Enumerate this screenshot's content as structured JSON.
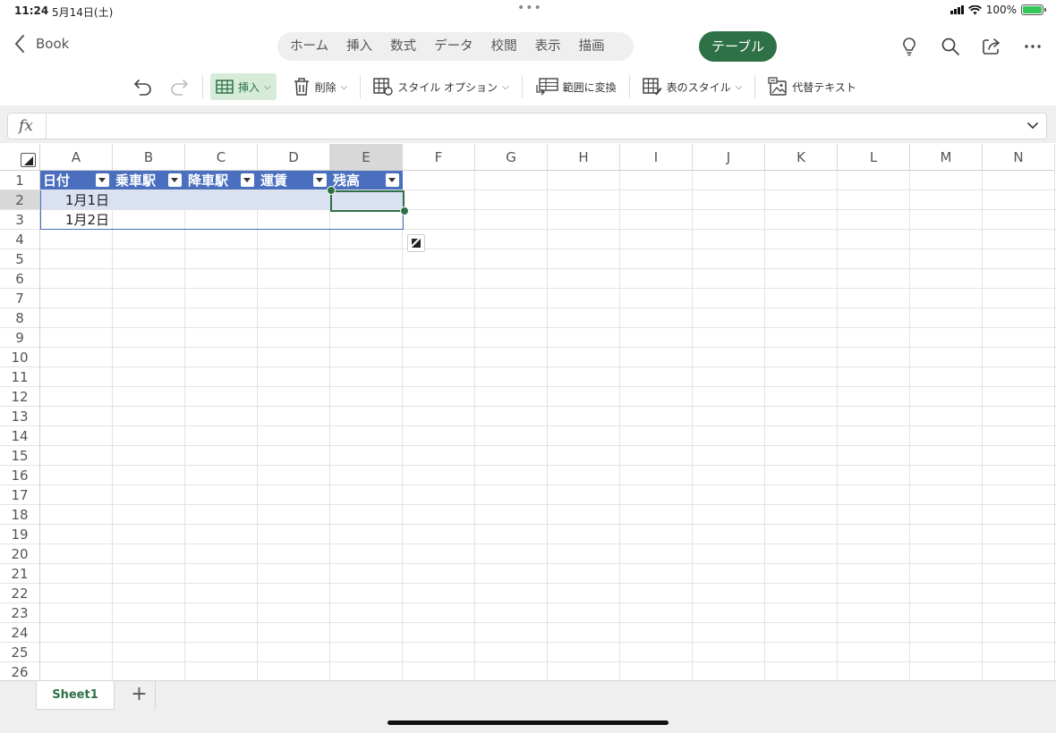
{
  "status": {
    "time": "11:24",
    "date": "5月14日(土)",
    "battery": "100%"
  },
  "nav": {
    "back_label": "Book",
    "tabs": [
      "ホーム",
      "挿入",
      "数式",
      "データ",
      "校閲",
      "表示",
      "描画"
    ],
    "active_tab": "テーブル"
  },
  "ribbon": {
    "insert": "挿入",
    "delete": "削除",
    "style_options": "スタイル オプション",
    "convert_range": "範囲に変換",
    "table_style": "表のスタイル",
    "alt_text": "代替テキスト"
  },
  "formula": {
    "fx": "fx",
    "value": ""
  },
  "grid": {
    "columns": [
      "A",
      "B",
      "C",
      "D",
      "E",
      "F",
      "G",
      "H",
      "I",
      "J",
      "K",
      "L",
      "M",
      "N"
    ],
    "selected_column": "E",
    "rows": [
      "1",
      "2",
      "3",
      "4",
      "5",
      "6",
      "7",
      "8",
      "9",
      "10",
      "11",
      "12",
      "13",
      "14",
      "15",
      "16",
      "17",
      "18",
      "19",
      "20",
      "21",
      "22",
      "23",
      "24",
      "25",
      "26"
    ],
    "selected_row": "2"
  },
  "table": {
    "headers": [
      "日付",
      "乗車駅",
      "降車駅",
      "運賃",
      "残高"
    ],
    "rows": [
      [
        "1月1日",
        "",
        "",
        "",
        ""
      ],
      [
        "1月2日",
        "",
        "",
        "",
        ""
      ]
    ]
  },
  "sheets": {
    "active": "Sheet1",
    "add": "+"
  },
  "colors": {
    "accent": "#2e7147",
    "table_header": "#4a6fbf",
    "table_band": "#d9e1f2"
  }
}
